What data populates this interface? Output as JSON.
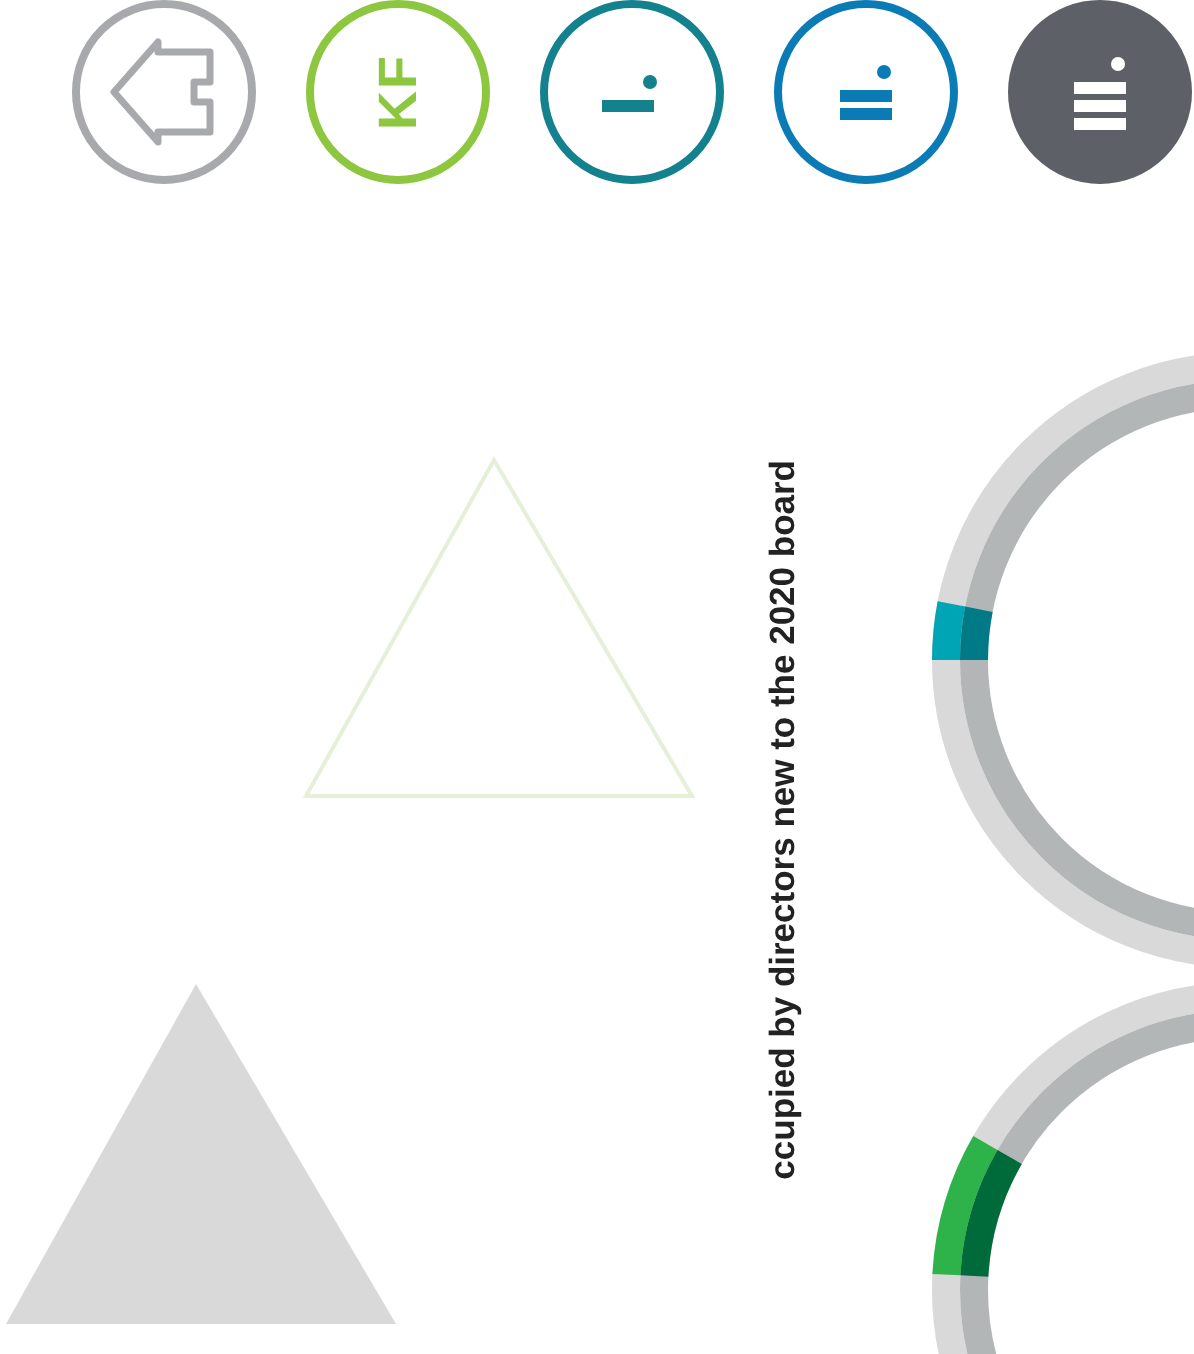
{
  "nav": [
    {
      "kind": "home",
      "color": "#a7a9ac",
      "selected": false
    },
    {
      "kind": "text",
      "label": "KF",
      "color": "#8dc63f",
      "selected": false
    },
    {
      "kind": "one-line",
      "color": "#13818e",
      "selected": false
    },
    {
      "kind": "two-lines",
      "color": "#0a7bb5",
      "selected": false
    },
    {
      "kind": "three-lines",
      "color": "#5d6067",
      "selected": true
    }
  ],
  "caption": "ccupied by directors new to the 2020 board"
}
